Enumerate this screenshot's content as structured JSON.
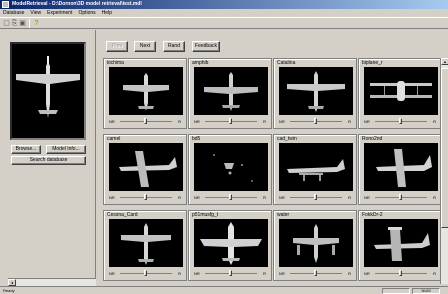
{
  "window": {
    "title": "ModelRetrieval - D:\\Dornon\\3D model retrieval\\test.mdl"
  },
  "menu": [
    "Database",
    "View",
    "Experiment",
    "Options",
    "Help"
  ],
  "toolbar": {
    "icons": [
      "new-icon",
      "open-icon",
      "save-icon",
      "help-icon"
    ]
  },
  "left": {
    "browse_label": "Browse...",
    "model_info_label": "Model Info...",
    "search_label": "Search database"
  },
  "nav": {
    "prev_label": "Prev",
    "next_label": "Next",
    "rand_label": "Rand",
    "feedback_label": "Feedback"
  },
  "results": [
    {
      "name": "kichima",
      "nr": "NR",
      "r": "R",
      "relevance": 0.5,
      "view": "top-a"
    },
    {
      "name": "amphib",
      "nr": "NR",
      "r": "R",
      "relevance": 0.5,
      "view": "top-b"
    },
    {
      "name": "Catalina",
      "nr": "NR",
      "r": "R",
      "relevance": 0.5,
      "view": "top-c"
    },
    {
      "name": "biplane_r",
      "nr": "NR",
      "r": "R",
      "relevance": 0.5,
      "view": "front"
    },
    {
      "name": "camel",
      "nr": "NR",
      "r": "R",
      "relevance": 0.5,
      "view": "side-a"
    },
    {
      "name": "bd5",
      "nr": "NR",
      "r": "R",
      "relevance": 0.5,
      "view": "sparse"
    },
    {
      "name": "cad_twin",
      "nr": "NR",
      "r": "R",
      "relevance": 0.5,
      "view": "side-b"
    },
    {
      "name": "Rono2nd",
      "nr": "NR",
      "r": "R",
      "relevance": 0.5,
      "view": "side-c"
    },
    {
      "name": "Cessna_Card",
      "nr": "NR",
      "r": "R",
      "relevance": 0.5,
      "view": "top-d"
    },
    {
      "name": "p51musfg_t",
      "nr": "NR",
      "r": "R",
      "relevance": 0.5,
      "view": "top-e"
    },
    {
      "name": "water",
      "nr": "NR",
      "r": "R",
      "relevance": 0.5,
      "view": "top-f"
    },
    {
      "name": "FokkDr-2",
      "nr": "NR",
      "r": "R",
      "relevance": 0.5,
      "view": "side-d"
    }
  ],
  "status": {
    "text": "Ready",
    "cells": [
      "",
      "NUM"
    ]
  },
  "colors": {
    "titlebar_start": "#0a246a",
    "titlebar_end": "#a6caf0",
    "face": "#d4d0c8"
  }
}
